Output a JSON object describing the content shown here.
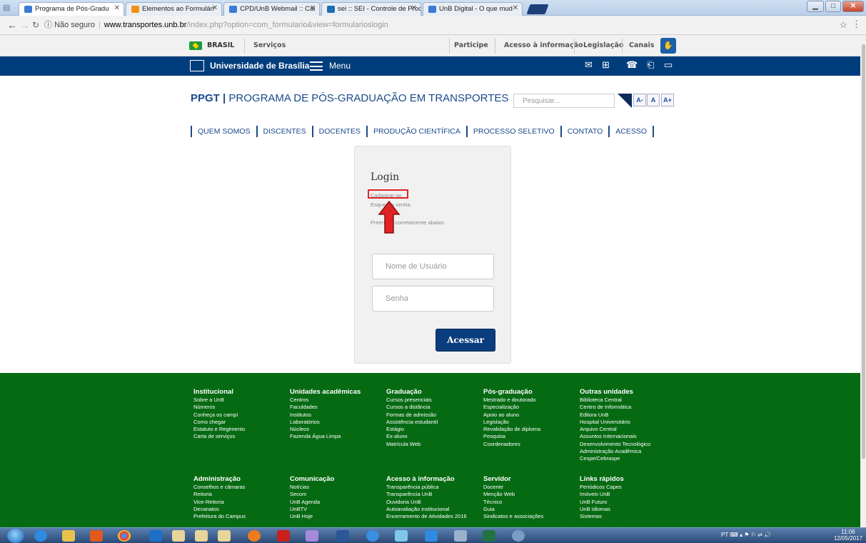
{
  "browser": {
    "tabs": [
      {
        "title": "Programa de Pós-Gradu",
        "color": "#3a7bd5"
      },
      {
        "title": "Elementos ao Formulári",
        "color": "#f29111"
      },
      {
        "title": "CPD/UnB Webmail :: Cai",
        "color": "#3a7bd5"
      },
      {
        "title": "sei :: SEI - Controle de Proce",
        "color": "#1f6db3"
      },
      {
        "title": "UnB Digital - O que mud",
        "color": "#3a7bd5"
      }
    ],
    "security": "Não seguro",
    "url_host": "www.transportes.unb.br",
    "url_path": "/index.php?option=com_formulario&view=formularioslogin"
  },
  "govbar": {
    "brasil": "BRASIL",
    "servicos": "Serviços",
    "participe": "Participe",
    "acesso_info": "Acesso à informação",
    "legislacao": "Legislação",
    "canais": "Canais"
  },
  "unbbar": {
    "name": "Universidade de Brasília",
    "menu": "Menu"
  },
  "header": {
    "acronym": "PPGT",
    "title": "PROGRAMA DE PÓS-GRADUAÇÃO EM TRANSPORTES",
    "search_placeholder": "Pesquisar...",
    "font_buttons": [
      "A-",
      "A",
      "A+"
    ]
  },
  "nav": [
    "QUEM SOMOS",
    "DISCENTES",
    "DOCENTES",
    "PRODUÇÃO CIENTÍFICA",
    "PROCESSO SELETIVO",
    "CONTATO",
    "ACESSO"
  ],
  "login": {
    "title": "Login",
    "register": "Cadastrar-se.",
    "forgot": "Esqueci a senha.",
    "instructions": "Preencha corretamente abaixo.",
    "username_placeholder": "Nome de Usuário",
    "password_placeholder": "Senha",
    "submit": "Acessar"
  },
  "footer": {
    "columns": [
      {
        "title": "Institucional",
        "items": [
          "Sobre a UnB",
          "Números",
          "Conheça os campi",
          "Como chegar",
          "Estatuto e Regimento",
          "Carta de serviços"
        ]
      },
      {
        "title": "Unidades acadêmicas",
        "items": [
          "Centros",
          "Faculdades",
          "Institutos",
          "Laboratórios",
          "Núcleos",
          "Fazenda Água Limpa"
        ]
      },
      {
        "title": "Graduação",
        "items": [
          "Cursos presenciais",
          "Cursos a distância",
          "Formas de admissão",
          "Assistência estudantil",
          "Estágio",
          "Ex-aluno",
          "Matrícula Web"
        ]
      },
      {
        "title": "Pós-graduação",
        "items": [
          "Mestrado e doutorado",
          "Especialização",
          "Apoio ao aluno",
          "Legislação",
          "Revalidação de diploma",
          "Pesquisa",
          "Coordenadores"
        ]
      },
      {
        "title": "Outras unidades",
        "items": [
          "Biblioteca Central",
          "Centro de Informática",
          "Editora UnB",
          "Hospital Universitário",
          "Arquivo Central",
          "Assuntos Internacionais",
          "Desenvolvimento Tecnológico",
          "Administração Acadêmica",
          "Cespe/Cebraspe"
        ]
      },
      {
        "title": "Administração",
        "items": [
          "Conselhos e câmaras",
          "Reitoria",
          "Vice-Reitoria",
          "Decanatos",
          "Prefeitura do Campus"
        ]
      },
      {
        "title": "Comunicação",
        "items": [
          "Notícias",
          "Secom",
          "UnB Agenda",
          "UnBTV",
          "UnB Hoje"
        ]
      },
      {
        "title": "Acesso à informação",
        "items": [
          "Transparência pública",
          "Transparência UnB",
          "Ouvidoria UnB",
          "Autoavaliação institucional",
          "Encerramento de Atividades 2016"
        ]
      },
      {
        "title": "Servidor",
        "items": [
          "Docente",
          "Menção Web",
          "Técnico",
          "Guia",
          "Sindicatos e associações"
        ]
      },
      {
        "title": "Links rápidos",
        "items": [
          "Periódicos Capes",
          "Imóveis UnB",
          "UnB Futuro",
          "UnB Idiomas",
          "Sistemas"
        ]
      }
    ]
  },
  "taskbar": {
    "lang": "PT",
    "time": "11:06",
    "date": "12/05/2017"
  },
  "colors": {
    "unb_blue": "#003d7c",
    "footer_green": "#066a13",
    "highlight_red": "#e02424"
  }
}
